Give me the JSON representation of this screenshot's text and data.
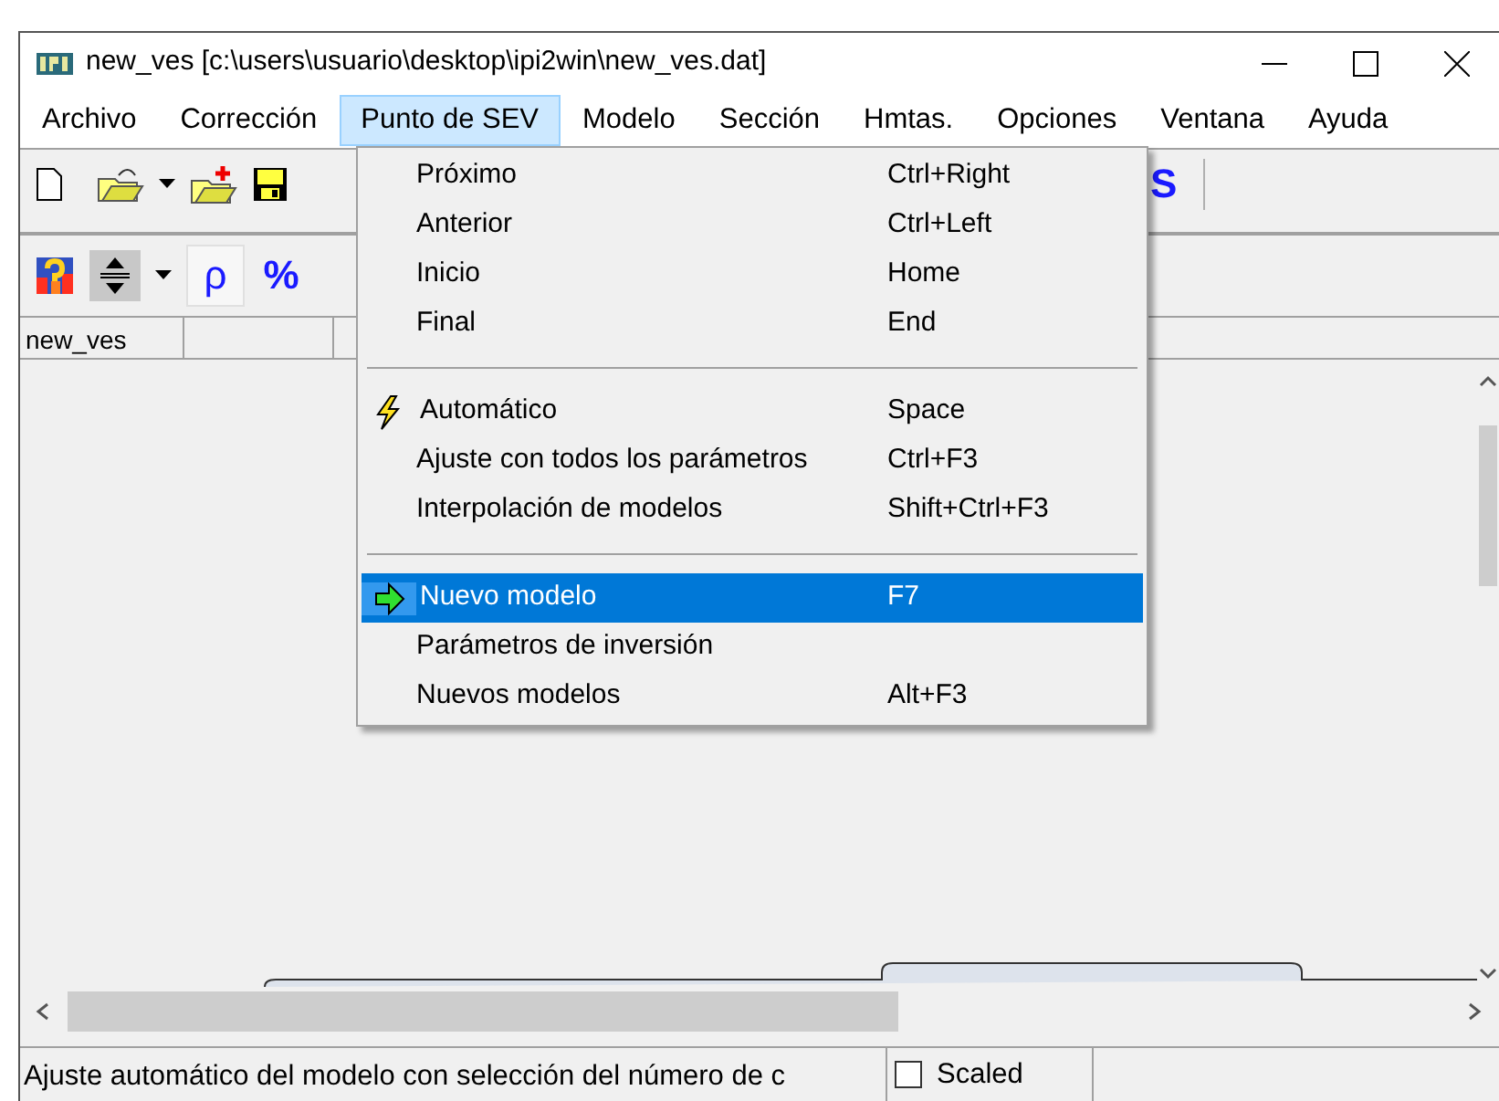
{
  "window": {
    "title": "new_ves [c:\\users\\usuario\\desktop\\ipi2win\\new_ves.dat]"
  },
  "menu_bar": [
    {
      "label": "Archivo",
      "selected": false
    },
    {
      "label": "Corrección",
      "selected": false
    },
    {
      "label": "Punto de SEV",
      "selected": true
    },
    {
      "label": "Modelo",
      "selected": false
    },
    {
      "label": "Sección",
      "selected": false
    },
    {
      "label": "Hmtas.",
      "selected": false
    },
    {
      "label": "Opciones",
      "selected": false
    },
    {
      "label": "Ventana",
      "selected": false
    },
    {
      "label": "Ayuda",
      "selected": false
    }
  ],
  "toolbar": {
    "fragment": "S"
  },
  "toolbar2": {
    "buttons": [
      {
        "label": "ρ",
        "pressed": true
      },
      {
        "label": "%",
        "pressed": false
      }
    ]
  },
  "header_cells": [
    "new_ves"
  ],
  "dropdown": {
    "items": [
      {
        "kind": "plain",
        "label": "Próximo",
        "shortcut": "Ctrl+Right",
        "selected": false
      },
      {
        "kind": "plain",
        "label": "Anterior",
        "shortcut": "Ctrl+Left",
        "selected": false
      },
      {
        "kind": "plain",
        "label": "Inicio",
        "shortcut": "Home",
        "selected": false
      },
      {
        "kind": "plain",
        "label": "Final",
        "shortcut": "End",
        "selected": false
      },
      {
        "kind": "separator"
      },
      {
        "kind": "bolt",
        "label": "Automático",
        "shortcut": "Space",
        "selected": false
      },
      {
        "kind": "plain",
        "label": "Ajuste con todos los parámetros",
        "shortcut": "Ctrl+F3",
        "selected": false
      },
      {
        "kind": "plain",
        "label": "Interpolación de modelos",
        "shortcut": "Shift+Ctrl+F3",
        "selected": false
      },
      {
        "kind": "separator"
      },
      {
        "kind": "arrow",
        "label": "Nuevo modelo",
        "shortcut": "F7",
        "selected": true
      },
      {
        "kind": "plain",
        "label": "Parámetros de inversión",
        "selected": false
      },
      {
        "kind": "plain",
        "label": "Nuevos modelos",
        "shortcut": "Alt+F3",
        "selected": false
      }
    ]
  },
  "status_bar": {
    "message": "Ajuste automático del modelo con selección del número de c",
    "scaled": {
      "label": "Scaled",
      "checked": false
    }
  }
}
